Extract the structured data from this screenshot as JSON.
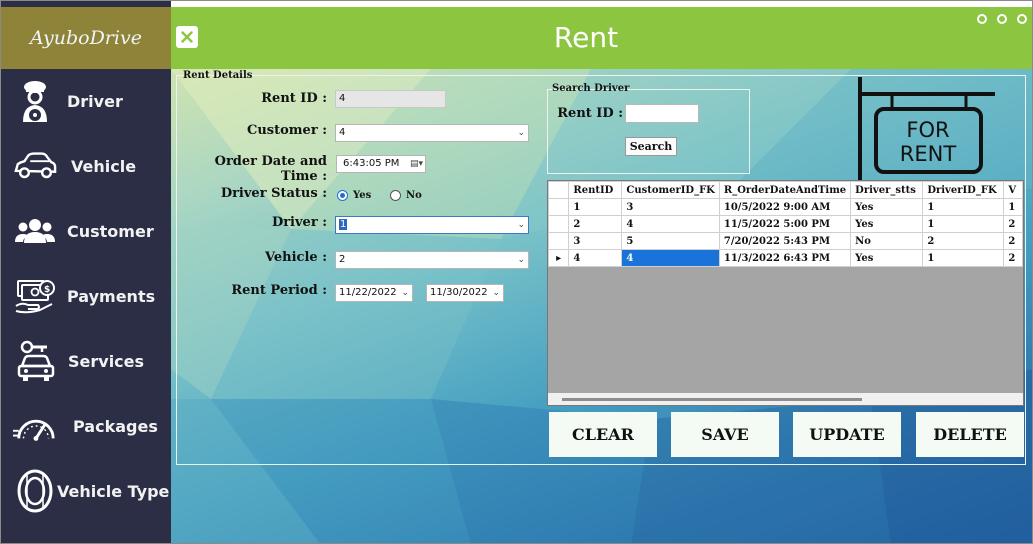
{
  "app": {
    "brand": "AyuboDrive",
    "title": "Rent"
  },
  "sidebar": {
    "items": [
      {
        "label": "Driver",
        "icon": "driver-icon"
      },
      {
        "label": "Vehicle",
        "icon": "car-icon"
      },
      {
        "label": "Customer",
        "icon": "people-icon"
      },
      {
        "label": "Payments",
        "icon": "payment-icon"
      },
      {
        "label": "Services",
        "icon": "service-car-icon"
      },
      {
        "label": "Packages",
        "icon": "speedometer-icon"
      },
      {
        "label": "Vehicle Type",
        "icon": "tire-icon"
      }
    ]
  },
  "rent_details": {
    "group_title": "Rent Details",
    "rent_id_label": "Rent ID :",
    "rent_id_value": "4",
    "customer_label": "Customer :",
    "customer_value": "4",
    "order_label": "Order Date and Time :",
    "order_value": "6:43:05 PM",
    "driver_status_label": "Driver Status :",
    "driver_status_options": [
      "Yes",
      "No"
    ],
    "driver_status_selected": "Yes",
    "driver_label": "Driver :",
    "driver_value": "1",
    "vehicle_label": "Vehicle :",
    "vehicle_value": "2",
    "rent_period_label": "Rent Period :",
    "rent_period_start": "11/22/2022",
    "rent_period_end": "11/30/2022"
  },
  "search": {
    "group_title": "Search Driver",
    "rent_id_label": "Rent ID :",
    "rent_id_value": "",
    "button_label": "Search"
  },
  "grid": {
    "columns": [
      "RentID",
      "CustomerID_FK",
      "R_OrderDateAndTime",
      "Driver_stts",
      "DriverID_FK",
      "V"
    ],
    "rows": [
      [
        "1",
        "3",
        "10/5/2022 9:00 AM",
        "Yes",
        "1",
        "1"
      ],
      [
        "2",
        "4",
        "11/5/2022 5:00 PM",
        "Yes",
        "1",
        "2"
      ],
      [
        "3",
        "5",
        "7/20/2022 5:43 PM",
        "No",
        "2",
        "2"
      ],
      [
        "4",
        "4",
        "11/3/2022 6:43 PM",
        "Yes",
        "1",
        "2"
      ]
    ],
    "current_row": 3,
    "selected_cell": [
      3,
      1
    ]
  },
  "actions": {
    "clear": "CLEAR",
    "save": "SAVE",
    "update": "UPDATE",
    "delete": "DELETE"
  },
  "sign": {
    "line1": "FOR",
    "line2": "RENT"
  },
  "colors": {
    "sidebar": "#2b2e45",
    "brand": "#8e8338",
    "header": "#8cc540",
    "selection": "#1a73d9"
  }
}
